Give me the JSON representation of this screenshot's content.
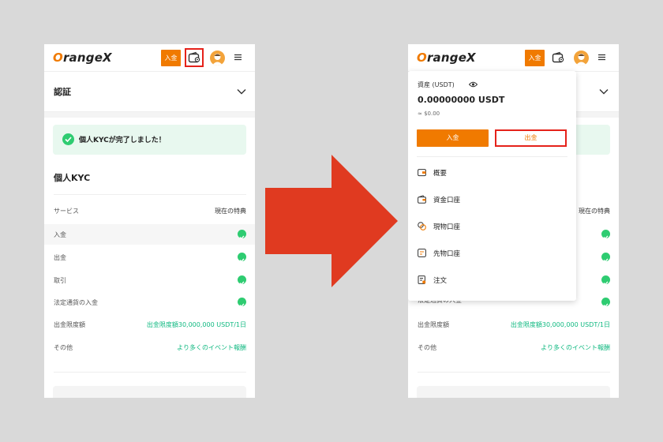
{
  "left": {
    "logo": {
      "first": "O",
      "rest": "rangeX"
    },
    "deposit_btn": "入金",
    "section_title": "認証",
    "banner": "個人KYCが完了しました！",
    "kyc_title": "個人KYC",
    "table_header": {
      "left": "サービス",
      "right": "現在の特典"
    },
    "rows": [
      {
        "label": "入金"
      },
      {
        "label": "出金"
      },
      {
        "label": "取引"
      },
      {
        "label": "法定通貨の入金"
      }
    ],
    "limit_row": {
      "label": "出金限度額",
      "value": "出金限度額30,000,000 USDT/1日"
    },
    "other_row": {
      "label": "その他",
      "value": "より多くのイベント報酬"
    }
  },
  "right": {
    "logo": {
      "first": "O",
      "rest": "rangeX"
    },
    "deposit_btn": "入金",
    "dropdown": {
      "asset_label": "資産 (USDT)",
      "balance": "0.00000000  USDT",
      "approx": "≈ $0.00",
      "deposit": "入金",
      "withdraw": "出金",
      "items": [
        {
          "label": "概要",
          "icon": "overview-icon"
        },
        {
          "label": "資金口座",
          "icon": "wallet-icon"
        },
        {
          "label": "現物口座",
          "icon": "spot-icon"
        },
        {
          "label": "先物口座",
          "icon": "futures-icon"
        },
        {
          "label": "注文",
          "icon": "order-icon"
        }
      ]
    },
    "visible_right": "現在の特典",
    "partial_row": "法定通貨の入金",
    "limit_row": {
      "label": "出金限度額",
      "value": "出金限度額30,000,000 USDT/1日"
    },
    "other_row": {
      "label": "その他",
      "value": "より多くのイベント報酬"
    }
  },
  "colors": {
    "brand": "#f07a00",
    "highlight": "#e5221a",
    "success": "#2ecc71",
    "arrow": "#e03a20"
  }
}
